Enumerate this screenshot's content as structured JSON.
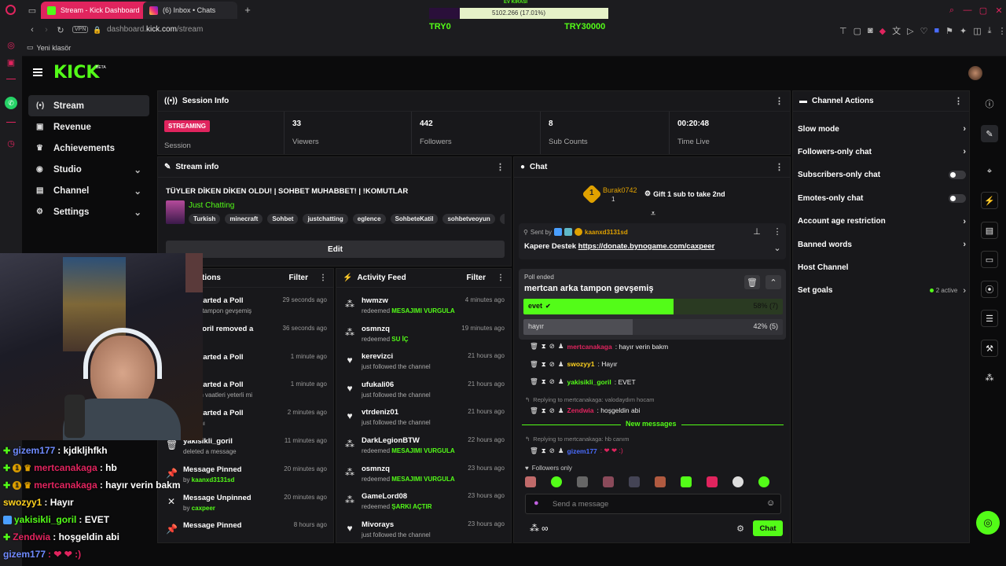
{
  "browser": {
    "tabs": [
      {
        "label": "Stream - Kick Dashboard",
        "active": true
      },
      {
        "label": "(6) Inbox • Chats",
        "active": false
      }
    ],
    "url_prefix": "dashboard.",
    "url_domain": "kick.com",
    "url_path": "/stream",
    "vpn": "VPN",
    "bookmark": "Yeni klasör",
    "goal": {
      "title": "EV KİRASI",
      "value": "5102.266 (17.01%)",
      "left": "TRY0",
      "right": "TRY30000",
      "progress": 0.1701
    }
  },
  "nav": {
    "items": [
      {
        "label": "Stream",
        "icon": "(•)",
        "chev": false
      },
      {
        "label": "Revenue",
        "icon": "▣",
        "chev": false
      },
      {
        "label": "Achievements",
        "icon": "♛",
        "chev": false
      },
      {
        "label": "Studio",
        "icon": "◉",
        "chev": true
      },
      {
        "label": "Channel",
        "icon": "▤",
        "chev": true
      },
      {
        "label": "Settings",
        "icon": "⚙",
        "chev": true
      }
    ]
  },
  "session": {
    "title": "Session Info",
    "status": "STREAMING",
    "status_label": "Session",
    "stats": [
      {
        "value": "33",
        "label": "Viewers"
      },
      {
        "value": "442",
        "label": "Followers"
      },
      {
        "value": "8",
        "label": "Sub Counts"
      },
      {
        "value": "00:20:48",
        "label": "Time Live"
      }
    ]
  },
  "stream_info": {
    "header": "Stream info",
    "title": "TÜYLER DİKEN DİKEN OLDU! | SOHBET MUHABBET! | !KOMUTLAR",
    "category": "Just Chatting",
    "tags": [
      "Turkish",
      "minecraft",
      "Sohbet",
      "justchatting",
      "eglence",
      "SohbeteKatil",
      "sohbetveoyun",
      "caxp"
    ],
    "edit": "Edit"
  },
  "moderation": {
    "header_partial": "tions",
    "filter": "Filter",
    "items": [
      {
        "title": "eer started a Poll",
        "sub": "n arka tampon gevşemiş",
        "time": "29 seconds ago",
        "icon": ""
      },
      {
        "title": "ikli_goril removed a",
        "sub": "n istifa",
        "time": "36 seconds ago",
        "icon": ""
      },
      {
        "title": "eer started a Poll",
        "sub": "n istifa",
        "time": "1 minute ago",
        "icon": ""
      },
      {
        "title": "eer started a Poll",
        "sub": "başkan vaatleri yeterli mi",
        "time": "1 minute ago",
        "icon": ""
      },
      {
        "title": "eer started a Poll",
        "sub": "başkanı",
        "time": "2 minutes ago",
        "icon": ""
      },
      {
        "title": "yakisikli_goril",
        "sub": "deleted a message",
        "time": "11 minutes ago",
        "icon": "🗑"
      },
      {
        "title": "Message Pinned",
        "sub_prefix": "by ",
        "sub_user": "kaanxd3131sd",
        "time": "20 minutes ago",
        "icon": "📌"
      },
      {
        "title": "Message Unpinned",
        "sub_prefix": "by ",
        "sub_user": "caxpeer",
        "time": "20 minutes ago",
        "icon": "✕"
      },
      {
        "title": "Message Pinned",
        "sub": "",
        "time": "8 hours ago",
        "icon": "📌"
      }
    ]
  },
  "activity": {
    "header": "Activity Feed",
    "filter": "Filter",
    "items": [
      {
        "user": "hwmzw",
        "action": "redeemed ",
        "reward": "MESAJIMI VURGULA",
        "time": "4 minutes ago",
        "icon": "⁂"
      },
      {
        "user": "osmnzq",
        "action": "redeemed ",
        "reward": "SU İÇ",
        "time": "19 minutes ago",
        "icon": "⁂"
      },
      {
        "user": "kerevizci",
        "action": "just followed the channel",
        "reward": "",
        "time": "21 hours ago",
        "icon": "♥"
      },
      {
        "user": "ufukali06",
        "action": "just followed the channel",
        "reward": "",
        "time": "21 hours ago",
        "icon": "♥"
      },
      {
        "user": "vtrdeniz01",
        "action": "just followed the channel",
        "reward": "",
        "time": "21 hours ago",
        "icon": "♥"
      },
      {
        "user": "DarkLegionBTW",
        "action": "redeemed ",
        "reward": "MESAJIMI VURGULA",
        "time": "22 hours ago",
        "icon": "⁂"
      },
      {
        "user": "osmnzq",
        "action": "redeemed ",
        "reward": "MESAJIMI VURGULA",
        "time": "23 hours ago",
        "icon": "⁂"
      },
      {
        "user": "GameLord08",
        "action": "redeemed ",
        "reward": "ŞARKI AÇTIR",
        "time": "23 hours ago",
        "icon": "⁂"
      },
      {
        "user": "Mivorays",
        "action": "just followed the channel",
        "reward": "",
        "time": "23 hours ago",
        "icon": "♥"
      }
    ]
  },
  "chat": {
    "header": "Chat",
    "gifter": {
      "rank": "1",
      "name": "Burak0742",
      "count": "1",
      "cta": "Gift 1 sub to take 2nd"
    },
    "pinned": {
      "sent_by": "Sent by",
      "user": "kaanxd3131sd",
      "text": "Kapere Destek ",
      "link": "https://donate.bynogame.com/caxpeer"
    },
    "poll": {
      "status": "Poll ended",
      "question": "mertcan arka tampon gevşemiş",
      "options": [
        {
          "label": "evet",
          "result": "58% (7)",
          "pct": 58,
          "winner": true
        },
        {
          "label": "hayır",
          "result": "42% (5)",
          "pct": 42,
          "winner": false
        }
      ]
    },
    "messages": [
      {
        "user": "mertcanakaga",
        "color": "#e0245e",
        "text": ": hayır verin bakm",
        "reply": ""
      },
      {
        "user": "swozyy1",
        "color": "#ffd21f",
        "text": ": Hayır",
        "reply": ""
      },
      {
        "user": "yakisikli_goril",
        "color": "#53fc18",
        "text": ": EVET",
        "reply": ""
      },
      {
        "user": "Zendwia",
        "color": "#e0245e",
        "text": ": hoşgeldin abi",
        "reply": "Replying to mertcanakaga: valodaydım hocam"
      }
    ],
    "new_messages": "New messages",
    "last": {
      "reply": "Replying to mertcanakaga: hb canım",
      "user": "gizem177",
      "color": "#4a6cff",
      "text": ": ❤ ❤ :)"
    },
    "followers_only": "Followers only",
    "placeholder": "Send a message",
    "send": "Chat",
    "infinity": "∞"
  },
  "channel_actions": {
    "header": "Channel Actions",
    "items": [
      {
        "label": "Slow mode",
        "type": "chev"
      },
      {
        "label": "Followers-only chat",
        "type": "chev"
      },
      {
        "label": "Subscribers-only chat",
        "type": "toggle"
      },
      {
        "label": "Emotes-only chat",
        "type": "toggle"
      },
      {
        "label": "Account age restriction",
        "type": "chev"
      },
      {
        "label": "Banned words",
        "type": "chev"
      },
      {
        "label": "Host Channel",
        "type": "none"
      },
      {
        "label": "Set goals",
        "type": "active"
      }
    ],
    "active_count": "2 active"
  },
  "overlay_chat": [
    {
      "user": "gizem177",
      "color": "#6f8bff",
      "text": " : kjdkljhfkh",
      "badges": "g"
    },
    {
      "user": "mertcanakaga",
      "color": "#e0245e",
      "text": " : hb",
      "badges": "g1c"
    },
    {
      "user": "mertcanakaga",
      "color": "#e0245e",
      "text": " : hayır verin bakm",
      "badges": "g1c"
    },
    {
      "user": "swozyy1",
      "color": "#ffd21f",
      "text": " : Hayır",
      "badges": ""
    },
    {
      "user": "yakisikli_goril",
      "color": "#53fc18",
      "text": " : EVET",
      "badges": "b"
    },
    {
      "user": "Zendwia",
      "color": "#e0245e",
      "text": " : hoşgeldin abi",
      "badges": "g"
    },
    {
      "user": "gizem177",
      "color": "#6f8bff",
      "text": " : ❤ ❤ :)",
      "badges": ""
    }
  ],
  "colors": {
    "kick_green": "#53fc18",
    "streaming_red": "#e0245e",
    "panel": "#18181b"
  }
}
